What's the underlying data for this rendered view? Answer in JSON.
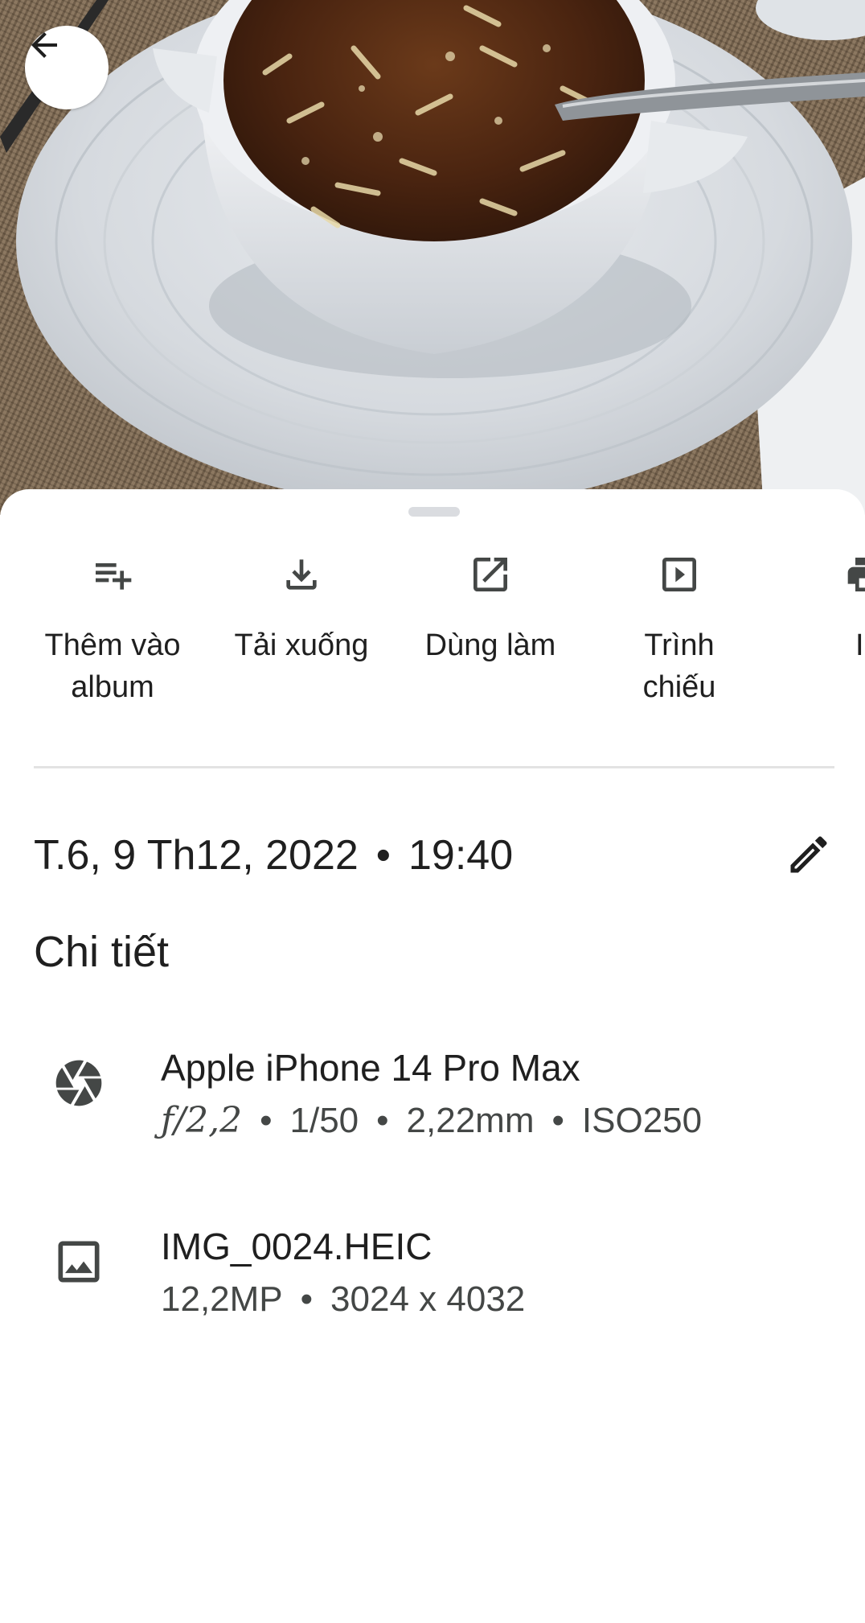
{
  "header": {
    "back_icon": "arrow-back-icon"
  },
  "actions": [
    {
      "icon": "playlist-add-icon",
      "label": "Thêm vào album"
    },
    {
      "icon": "download-icon",
      "label": "Tải xuống"
    },
    {
      "icon": "open-in-new-icon",
      "label": "Dùng làm"
    },
    {
      "icon": "slideshow-icon",
      "label": "Trình chiếu"
    },
    {
      "icon": "print-icon",
      "label": "I"
    }
  ],
  "datetime": {
    "date": "T.6, 9 Th12, 2022",
    "separator": "•",
    "time": "19:40",
    "edit_icon": "pencil-icon"
  },
  "details": {
    "title": "Chi tiết",
    "camera": {
      "icon": "camera-aperture-icon",
      "model": "Apple iPhone 14 Pro Max",
      "aperture": "ƒ/2,2",
      "shutter": "1/50",
      "focal_length": "2,22mm",
      "iso": "ISO250",
      "separator": "•"
    },
    "file": {
      "icon": "image-icon",
      "name": "IMG_0024.HEIC",
      "megapixels": "12,2MP",
      "resolution": "3024 x 4032",
      "separator": "•"
    }
  },
  "colors": {
    "text_primary": "#1f1f1f",
    "text_secondary": "#444746",
    "divider": "#e3e3e3",
    "sheet_background": "#ffffff"
  }
}
